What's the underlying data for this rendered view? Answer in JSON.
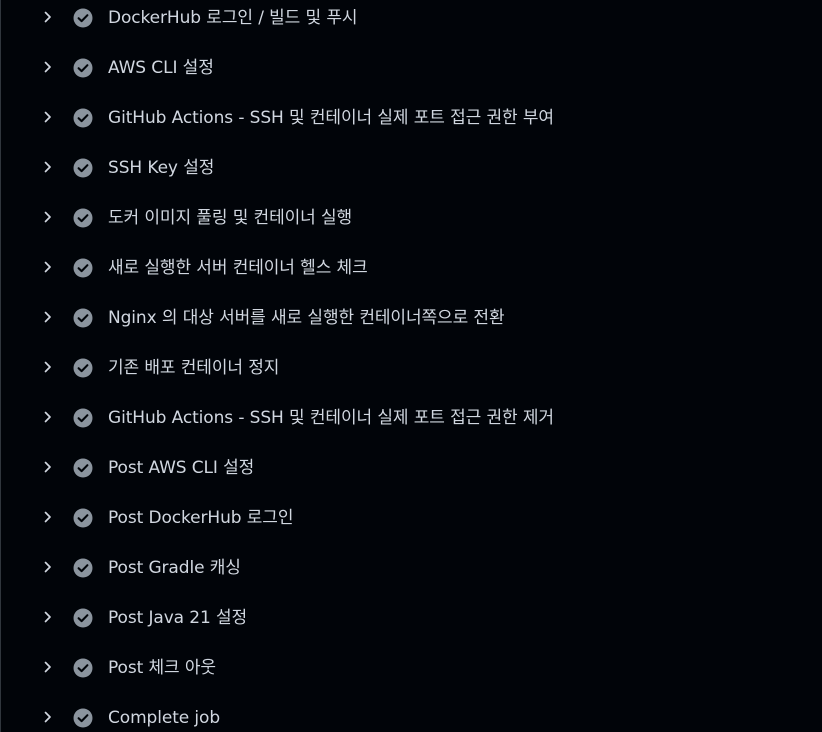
{
  "colors": {
    "background": "#010409",
    "text": "#d1d7e0",
    "icon": "#8b949e",
    "divider": "#30363d"
  },
  "steps": [
    {
      "label": "DockerHub 로그인 / 빌드 및 푸시",
      "status": "success",
      "icon": "check-circle-icon"
    },
    {
      "label": "AWS CLI 설정",
      "status": "success",
      "icon": "check-circle-icon"
    },
    {
      "label": "GitHub Actions - SSH 및 컨테이너 실제 포트 접근 권한 부여",
      "status": "success",
      "icon": "check-circle-icon"
    },
    {
      "label": "SSH Key 설정",
      "status": "success",
      "icon": "check-circle-icon"
    },
    {
      "label": "도커 이미지 풀링 및 컨테이너 실행",
      "status": "success",
      "icon": "check-circle-icon"
    },
    {
      "label": "새로 실행한 서버 컨테이너 헬스 체크",
      "status": "success",
      "icon": "check-circle-icon"
    },
    {
      "label": "Nginx 의 대상 서버를 새로 실행한 컨테이너쪽으로 전환",
      "status": "success",
      "icon": "check-circle-icon"
    },
    {
      "label": "기존 배포 컨테이너 정지",
      "status": "success",
      "icon": "check-circle-icon"
    },
    {
      "label": "GitHub Actions - SSH 및 컨테이너 실제 포트 접근 권한 제거",
      "status": "success",
      "icon": "check-circle-icon"
    },
    {
      "label": "Post AWS CLI 설정",
      "status": "success",
      "icon": "check-circle-icon"
    },
    {
      "label": "Post DockerHub 로그인",
      "status": "success",
      "icon": "check-circle-icon"
    },
    {
      "label": "Post Gradle 캐싱",
      "status": "success",
      "icon": "check-circle-icon"
    },
    {
      "label": "Post Java 21 설정",
      "status": "success",
      "icon": "check-circle-icon"
    },
    {
      "label": "Post 체크 아웃",
      "status": "success",
      "icon": "check-circle-icon"
    },
    {
      "label": "Complete job",
      "status": "success",
      "icon": "check-circle-icon"
    }
  ]
}
